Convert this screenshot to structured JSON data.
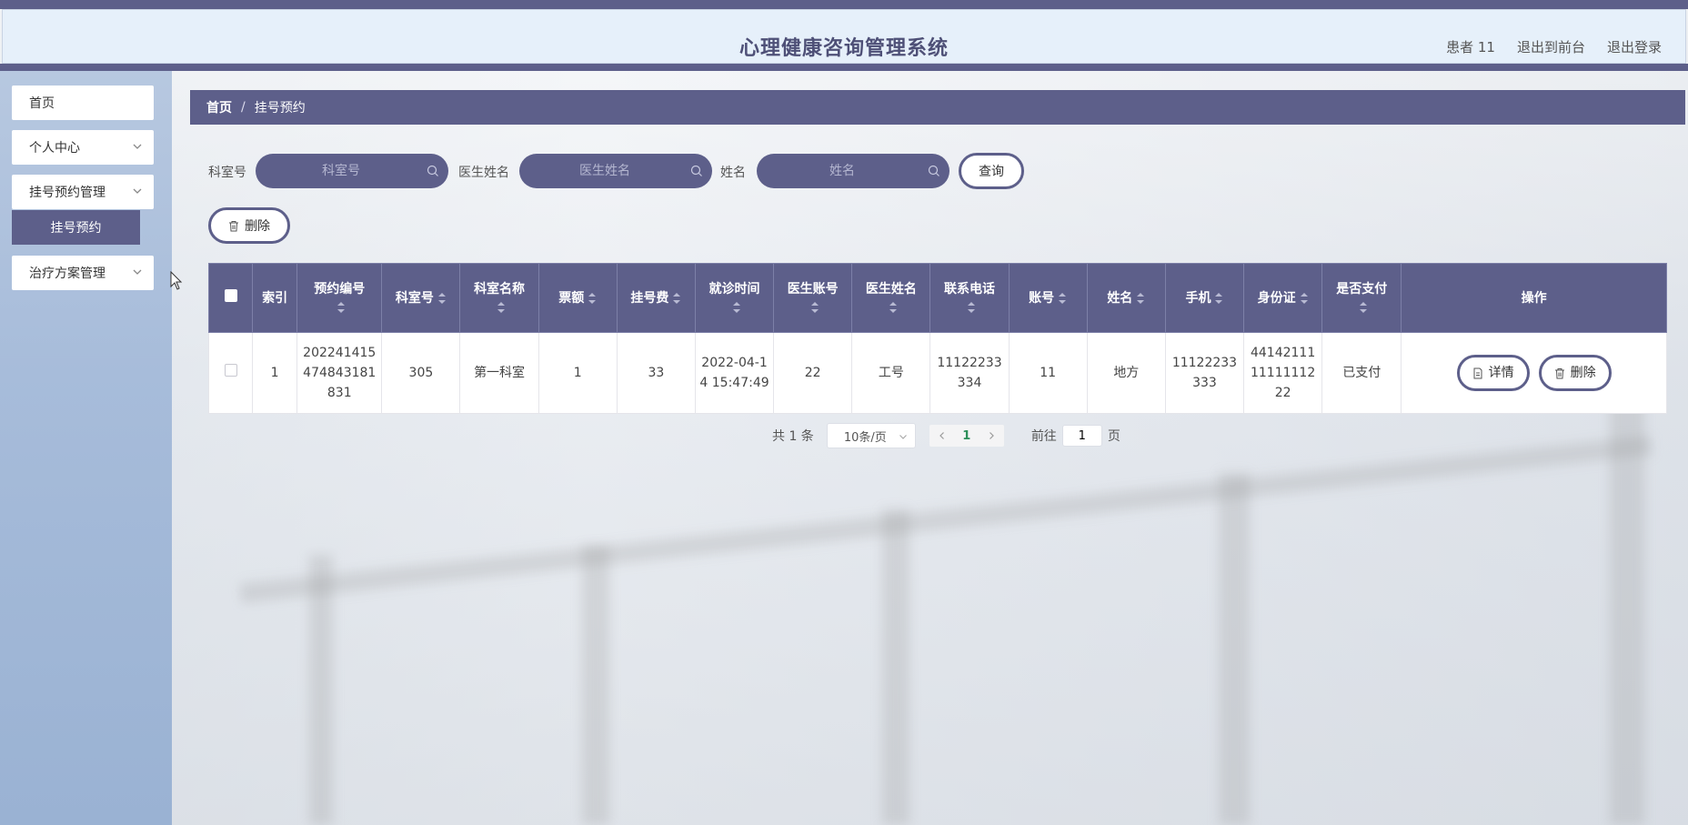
{
  "header": {
    "title": "心理健康咨询管理系统",
    "links": [
      "患者 11",
      "退出到前台",
      "退出登录"
    ]
  },
  "sidebar": {
    "items": [
      {
        "label": "首页"
      },
      {
        "label": "个人中心"
      },
      {
        "label": "挂号预约管理"
      },
      {
        "label": "治疗方案管理"
      }
    ],
    "active_sub": "挂号预约"
  },
  "breadcrumb": {
    "home": "首页",
    "sep": "/",
    "current": "挂号预约"
  },
  "search": {
    "room_label": "科室号",
    "room_placeholder": "科室号",
    "doctor_label": "医生姓名",
    "doctor_placeholder": "医生姓名",
    "name_label": "姓名",
    "name_placeholder": "姓名",
    "query_button": "查询"
  },
  "actions": {
    "delete": "删除"
  },
  "table": {
    "headers": [
      "索引",
      "预约编号",
      "科室号",
      "科室名称",
      "票额",
      "挂号费",
      "就诊时间",
      "医生账号",
      "医生姓名",
      "联系电话",
      "账号",
      "姓名",
      "手机",
      "身份证",
      "是否支付",
      "操作"
    ],
    "rows": [
      {
        "index": "1",
        "appt_no": "202241415474843181831",
        "room_no": "305",
        "room_name": "第一科室",
        "quota": "1",
        "fee": "33",
        "visit_time": "2022-04-14 15:47:49",
        "doctor_account": "22",
        "doctor_name": "工号",
        "phone": "11122233334",
        "account": "11",
        "name": "地方",
        "mobile": "11122233333",
        "id_card": "441421111111111222",
        "paid": "已支付",
        "detail_btn": "详情",
        "delete_btn": "删除"
      }
    ]
  },
  "pagination": {
    "total": "共 1 条",
    "page_size": "10条/页",
    "current_page": "1",
    "goto_label": "前往",
    "goto_value": "1",
    "page_suffix": "页"
  },
  "colors": {
    "primary": "#5d5f8a",
    "sidebar": "#a7bcda",
    "header_bg": "#e6f0fa",
    "page_active": "#2d8f5a"
  }
}
